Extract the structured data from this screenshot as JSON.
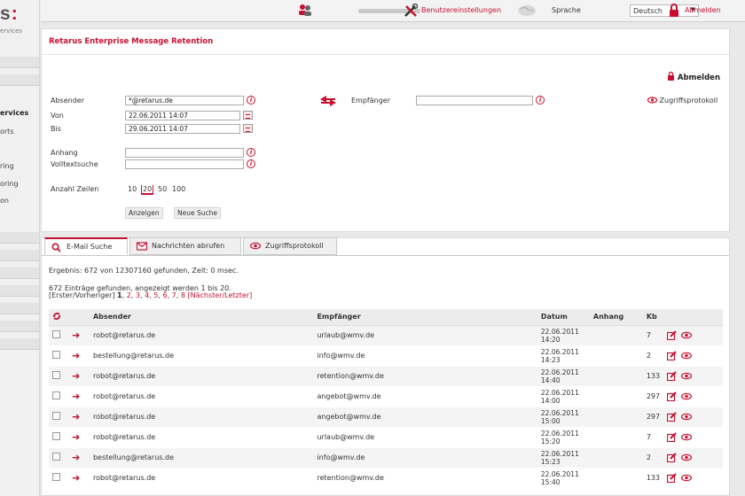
{
  "sidebar": {
    "logo": "s",
    "logo_dots": ":",
    "logo_sub": "ervices",
    "items": [
      {
        "label": ""
      },
      {
        "label": ""
      },
      {
        "label": "ervices",
        "active": true
      },
      {
        "label": "orts"
      },
      {
        "label": "ring"
      },
      {
        "label": "oring"
      },
      {
        "label": "on"
      },
      {
        "label": ""
      },
      {
        "label": ""
      },
      {
        "label": ""
      },
      {
        "label": ""
      },
      {
        "label": ""
      },
      {
        "label": ""
      },
      {
        "label": ""
      },
      {
        "label": ""
      }
    ]
  },
  "topbar": {
    "settings": "Benutzereinstellungen",
    "language_label": "Sprache",
    "language_value": "Deutsch",
    "logout": "Abmelden"
  },
  "main": {
    "title": "Retarus Enterprise Message Retention",
    "logout": "Abmelden",
    "absender_label": "Absender",
    "absender_value": "*@retarus.de",
    "empfaenger_label": "Empfänger",
    "empfaenger_value": "",
    "zugriff_label": "Zugriffsprotokoll",
    "von_label": "Von",
    "von_value": "22.06.2011 14:07",
    "bis_label": "Bis",
    "bis_value": "29.06.2011 14:07",
    "anhang_label": "Anhang",
    "anhang_value": "",
    "volltext_label": "Volltextsuche",
    "volltext_value": "",
    "zeilen_label": "Anzahl Zeilen",
    "zeilen": [
      "10",
      "20",
      "50",
      "100"
    ],
    "zeilen_selected": "20",
    "btn_anzeigen": "Anzeigen",
    "btn_neue": "Neue Suche"
  },
  "tabs": [
    {
      "label": "E-Mail Suche",
      "icon": "search-icon",
      "active": true
    },
    {
      "label": "Nachrichten abrufen",
      "icon": "envelope-icon"
    },
    {
      "label": "Zugriffsprotokoll",
      "icon": "eye-icon"
    }
  ],
  "results": {
    "summary": "Ergebnis: 672 von 12307160 gefunden, Zeit: 0 msec.",
    "found": "672 Einträge gefunden, angezeigt werden 1 bis 20.",
    "pager_prefix": "[Erster/Vorheriger]",
    "pages": [
      "1",
      "2",
      "3",
      "4",
      "5",
      "6",
      "7",
      "8"
    ],
    "pager_suffix": "[Nächster/Letzter]",
    "columns": {
      "absender": "Absender",
      "empfaenger": "Empfänger",
      "datum": "Datum",
      "anhang": "Anhang",
      "kb": "Kb"
    },
    "rows": [
      {
        "from": "robot@retarus.de",
        "to": "urlaub@wmv.de",
        "date": "22.06.2011",
        "time": "14:20",
        "anhang": "",
        "kb": "7"
      },
      {
        "from": "bestellung@retarus.de",
        "to": "info@wmv.de",
        "date": "22.06.2011",
        "time": "14:23",
        "anhang": "",
        "kb": "2"
      },
      {
        "from": "robot@retarus.de",
        "to": "retention@wmv.de",
        "date": "22.06.2011",
        "time": "14:40",
        "anhang": "",
        "kb": "133"
      },
      {
        "from": "robot@retarus.de",
        "to": "angebot@wmv.de",
        "date": "22.06.2011",
        "time": "14:00",
        "anhang": "",
        "kb": "297"
      },
      {
        "from": "robot@retarus.de",
        "to": "angebot@wmv.de",
        "date": "22.06.2011",
        "time": "15:00",
        "anhang": "",
        "kb": "297"
      },
      {
        "from": "robot@retarus.de",
        "to": "urlaub@wmv.de",
        "date": "22.06.2011",
        "time": "15:20",
        "anhang": "",
        "kb": "7"
      },
      {
        "from": "bestellung@retarus.de",
        "to": "info@wmv.de",
        "date": "22.06.2011",
        "time": "15:23",
        "anhang": "",
        "kb": "2"
      },
      {
        "from": "robot@retarus.de",
        "to": "retention@wmv.de",
        "date": "22.06.2011",
        "time": "15:40",
        "anhang": "",
        "kb": "133"
      }
    ]
  },
  "colors": {
    "accent": "#c8102e"
  }
}
